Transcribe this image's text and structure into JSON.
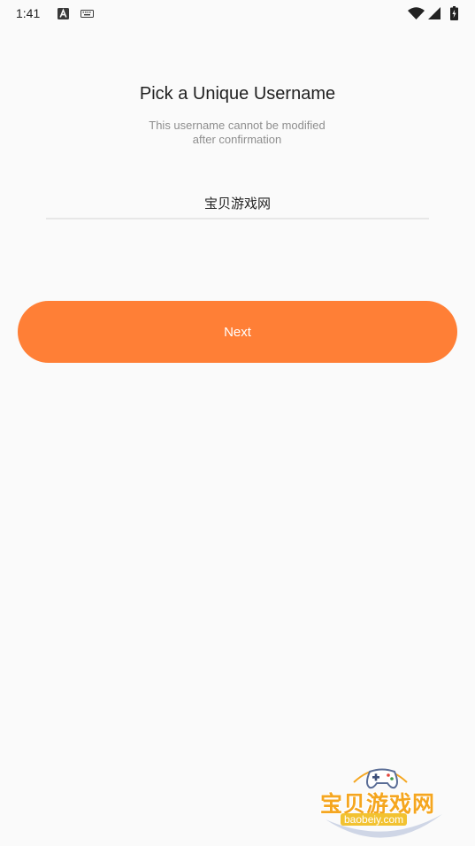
{
  "status_bar": {
    "time": "1:41",
    "icons": [
      "text-a-icon",
      "keyboard-icon",
      "wifi-icon",
      "signal-icon",
      "battery-icon"
    ]
  },
  "header": {
    "title": "Pick a Unique Username",
    "subtitle_line1": "This username cannot be modified",
    "subtitle_line2": "after confirmation"
  },
  "form": {
    "username_value": "宝贝游戏网"
  },
  "actions": {
    "next_label": "Next"
  },
  "watermark": {
    "text": "宝贝游戏网",
    "domain": "baobeiy.com"
  },
  "colors": {
    "accent": "#ff7f36",
    "background": "#fafafa",
    "title_text": "#1f1f1f",
    "subtitle_text": "#8e8e8e",
    "underline": "#e7e7e7"
  }
}
